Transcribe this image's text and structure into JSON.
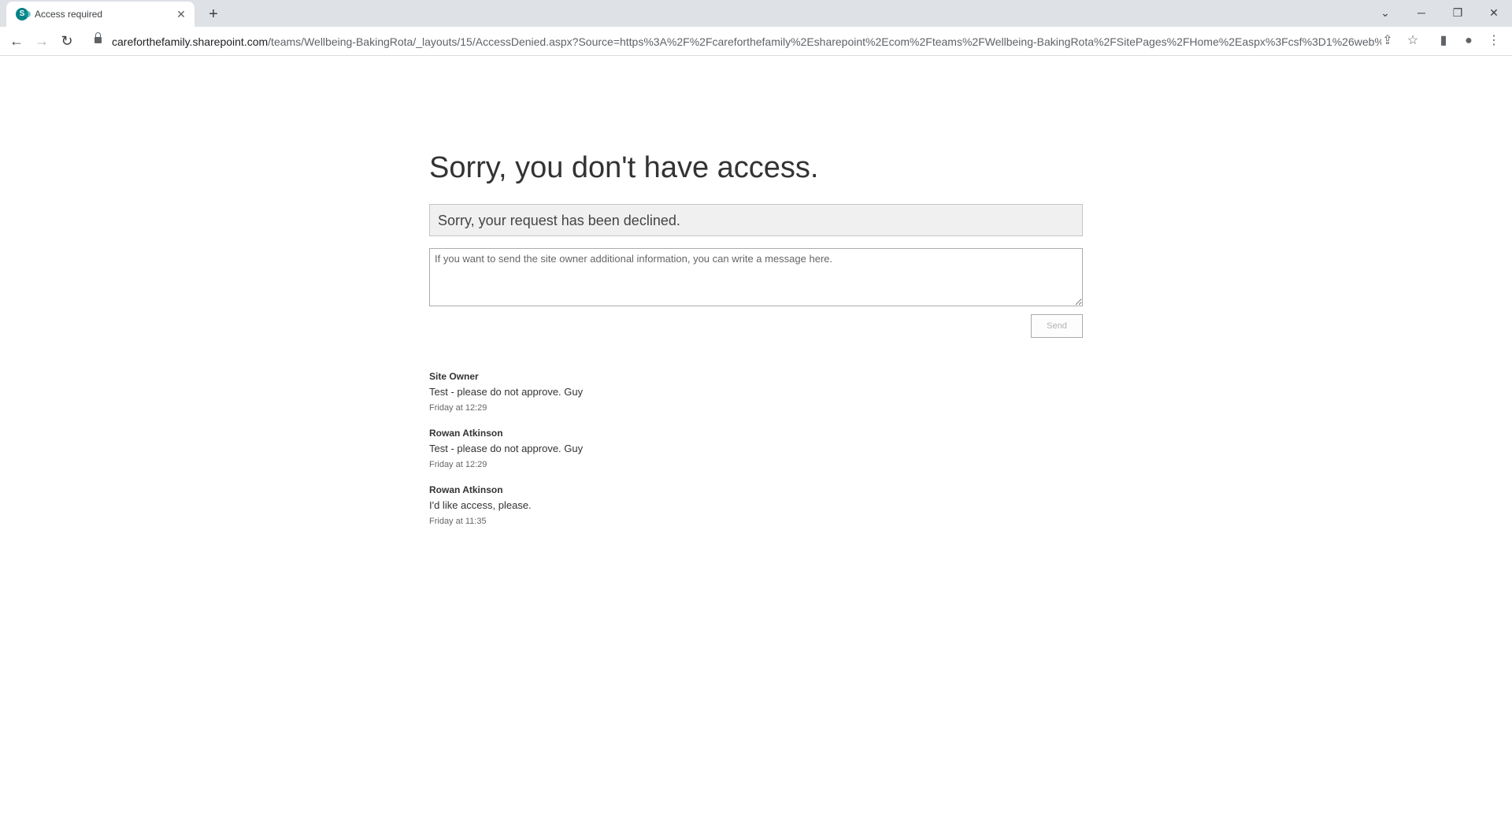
{
  "browser": {
    "tab_title": "Access required",
    "tab_favicon_letter": "S",
    "url_domain": "careforthefamily.sharepoint.com",
    "url_path": "/teams/Wellbeing-BakingRota/_layouts/15/AccessDenied.aspx?Source=https%3A%2F%2Fcareforthefamily%2Esharepoint%2Ecom%2Fteams%2FWellbeing-BakingRota%2FSitePages%2FHome%2Easpx%3Fcsf%3D1%26web%3D..."
  },
  "page": {
    "heading": "Sorry, you don't have access.",
    "status_message": "Sorry, your request has been declined.",
    "message_placeholder": "If you want to send the site owner additional information, you can write a message here.",
    "send_label": "Send"
  },
  "thread": [
    {
      "author": "Site Owner",
      "message": "Test - please do not approve.  Guy",
      "time": "Friday at 12:29"
    },
    {
      "author": "Rowan Atkinson",
      "message": "Test - please do not approve.  Guy",
      "time": "Friday at 12:29"
    },
    {
      "author": "Rowan Atkinson",
      "message": "I'd like access, please.",
      "time": "Friday at 11:35"
    }
  ],
  "colors": {
    "sharepoint_brand": "#038387",
    "chrome_tabstrip": "#dee1e6"
  }
}
